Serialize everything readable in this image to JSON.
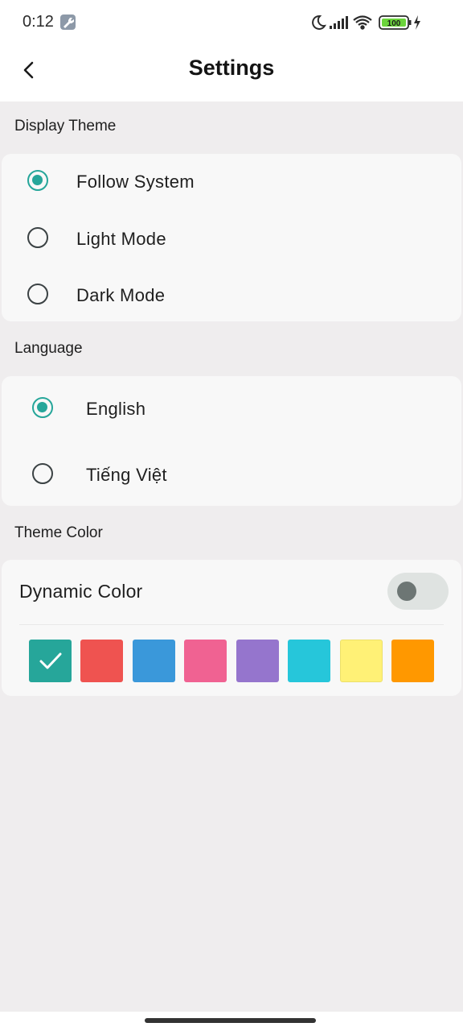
{
  "status_bar": {
    "time": "0:12",
    "battery_level": "100",
    "icons": [
      "wrench-icon",
      "moon-icon",
      "signal-icon",
      "wifi-icon",
      "battery-icon",
      "charging-icon"
    ]
  },
  "app_bar": {
    "title": "Settings",
    "back_icon": "chevron-left-icon"
  },
  "display_theme": {
    "title": "Display Theme",
    "options": [
      {
        "label": "Follow System",
        "selected": true
      },
      {
        "label": "Light Mode",
        "selected": false
      },
      {
        "label": "Dark Mode",
        "selected": false
      }
    ]
  },
  "language": {
    "title": "Language",
    "options": [
      {
        "label": "English",
        "selected": true
      },
      {
        "label": "Tiếng Việt",
        "selected": false
      }
    ]
  },
  "theme_color": {
    "title": "Theme Color",
    "dynamic_color_label": "Dynamic Color",
    "dynamic_color_enabled": false,
    "selected_index": 0,
    "swatches": [
      "#26a69a",
      "#ef5350",
      "#3a98da",
      "#f06292",
      "#9575cd",
      "#26c6da",
      "#fff176",
      "#ff9800"
    ]
  },
  "colors": {
    "accent": "#26a69a",
    "background": "#efedee",
    "card": "#f8f8f8"
  }
}
